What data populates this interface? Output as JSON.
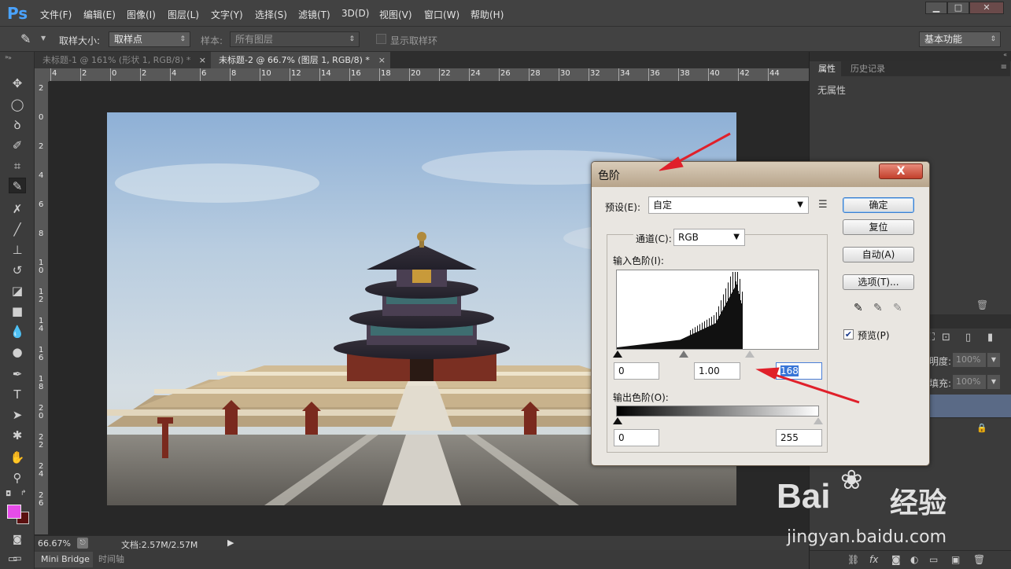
{
  "app": {
    "logo": "Ps"
  },
  "menu": [
    "文件(F)",
    "编辑(E)",
    "图像(I)",
    "图层(L)",
    "文字(Y)",
    "选择(S)",
    "滤镜(T)",
    "3D(D)",
    "视图(V)",
    "窗口(W)",
    "帮助(H)"
  ],
  "window_buttons": {
    "minimize": "▁",
    "maximize": "□",
    "close": "✕"
  },
  "options": {
    "sample_size_label": "取样大小:",
    "sample_size_value": "取样点",
    "sample_label": "样本:",
    "sample_value": "所有图层",
    "show_ring_label": "显示取样环",
    "workspace": "基本功能"
  },
  "tabs": [
    {
      "label": "未标题-1 @ 161% (形状 1, RGB/8) *",
      "close": "×"
    },
    {
      "label": "未标题-2 @ 66.7% (图层 1, RGB/8) *",
      "close": "×"
    }
  ],
  "ruler_top": [
    "4",
    "2",
    "0",
    "2",
    "4",
    "6",
    "8",
    "10",
    "12",
    "14",
    "16",
    "18",
    "20",
    "22",
    "24",
    "26",
    "28",
    "30",
    "32",
    "34",
    "36",
    "38",
    "40",
    "42",
    "44"
  ],
  "ruler_left": [
    "2",
    "0",
    "2",
    "4",
    "6",
    "8",
    "1\n0",
    "1\n2",
    "1\n4",
    "1\n6",
    "1\n8",
    "2\n0",
    "2\n2",
    "2\n4",
    "2\n6"
  ],
  "status": {
    "zoom": "66.67%",
    "doc": "文档:2.57M/2.57M"
  },
  "bottom_tabs": [
    "Mini Bridge",
    "时间轴"
  ],
  "right_panel": {
    "tabs": [
      "属性",
      "历史记录"
    ],
    "empty_label": "无属性",
    "opacity_label": "明度:",
    "opacity_value": "100%",
    "fill_label": "填充:",
    "fill_value": "100%"
  },
  "levels_dialog": {
    "title": "色阶",
    "close_label": "X",
    "preset_label": "预设(E):",
    "preset_value": "自定",
    "channel_label": "通道(C):",
    "channel_value": "RGB",
    "input_label": "输入色阶(I):",
    "input_black": "0",
    "input_gamma": "1.00",
    "input_white": "168",
    "output_label": "输出色阶(O):",
    "output_black": "0",
    "output_white": "255",
    "buttons": {
      "ok": "确定",
      "reset": "复位",
      "auto": "自动(A)",
      "options": "选项(T)..."
    },
    "preview_label": "预览(P)",
    "preview_checked": true
  },
  "watermark": {
    "brand": "Bai",
    "brand_suffix": "经验",
    "url": "jingyan.baidu.com"
  },
  "colors": {
    "foreground": "#e64ce8",
    "background": "#5a1010",
    "accent_arrow": "#e0202a"
  }
}
